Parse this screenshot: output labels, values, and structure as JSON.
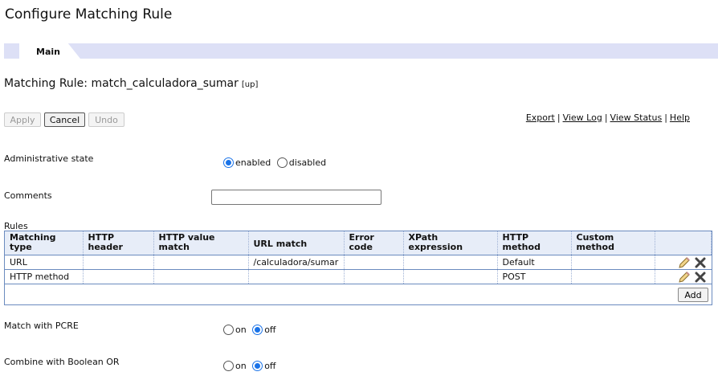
{
  "page": {
    "title": "Configure Matching Rule"
  },
  "tabs": [
    {
      "label": "Main"
    }
  ],
  "rule": {
    "heading_prefix": "Matching Rule: ",
    "name": "match_calculadora_sumar",
    "up_link": "[up]"
  },
  "toolbar": {
    "apply_label": "Apply",
    "cancel_label": "Cancel",
    "undo_label": "Undo"
  },
  "links": {
    "export": "Export",
    "view_log": "View Log",
    "view_status": "View Status",
    "help": "Help",
    "separator": "|"
  },
  "admin_state": {
    "label": "Administrative state",
    "options": [
      "enabled",
      "disabled"
    ],
    "selected": "enabled"
  },
  "comments": {
    "label": "Comments",
    "value": ""
  },
  "rules": {
    "label": "Rules",
    "headers": [
      "Matching type",
      "HTTP header",
      "HTTP value match",
      "URL match",
      "Error code",
      "XPath expression",
      "HTTP method",
      "Custom method"
    ],
    "rows": [
      [
        "URL",
        "",
        "",
        "/calculadora/sumar",
        "",
        "",
        "Default",
        ""
      ],
      [
        "HTTP method",
        "",
        "",
        "",
        "",
        "",
        "POST",
        ""
      ]
    ],
    "add_label": "Add"
  },
  "pcre": {
    "label": "Match with PCRE",
    "options": [
      "on",
      "off"
    ],
    "selected": "off"
  },
  "boolean_or": {
    "label": "Combine with Boolean OR",
    "options": [
      "on",
      "off"
    ],
    "selected": "off"
  },
  "icons": {
    "edit": "pencil-icon",
    "delete": "delete-x-icon"
  },
  "colors": {
    "accent": "#1a73e8",
    "tab_bar": "#dde0f6",
    "table_border": "#6b8bbf"
  }
}
